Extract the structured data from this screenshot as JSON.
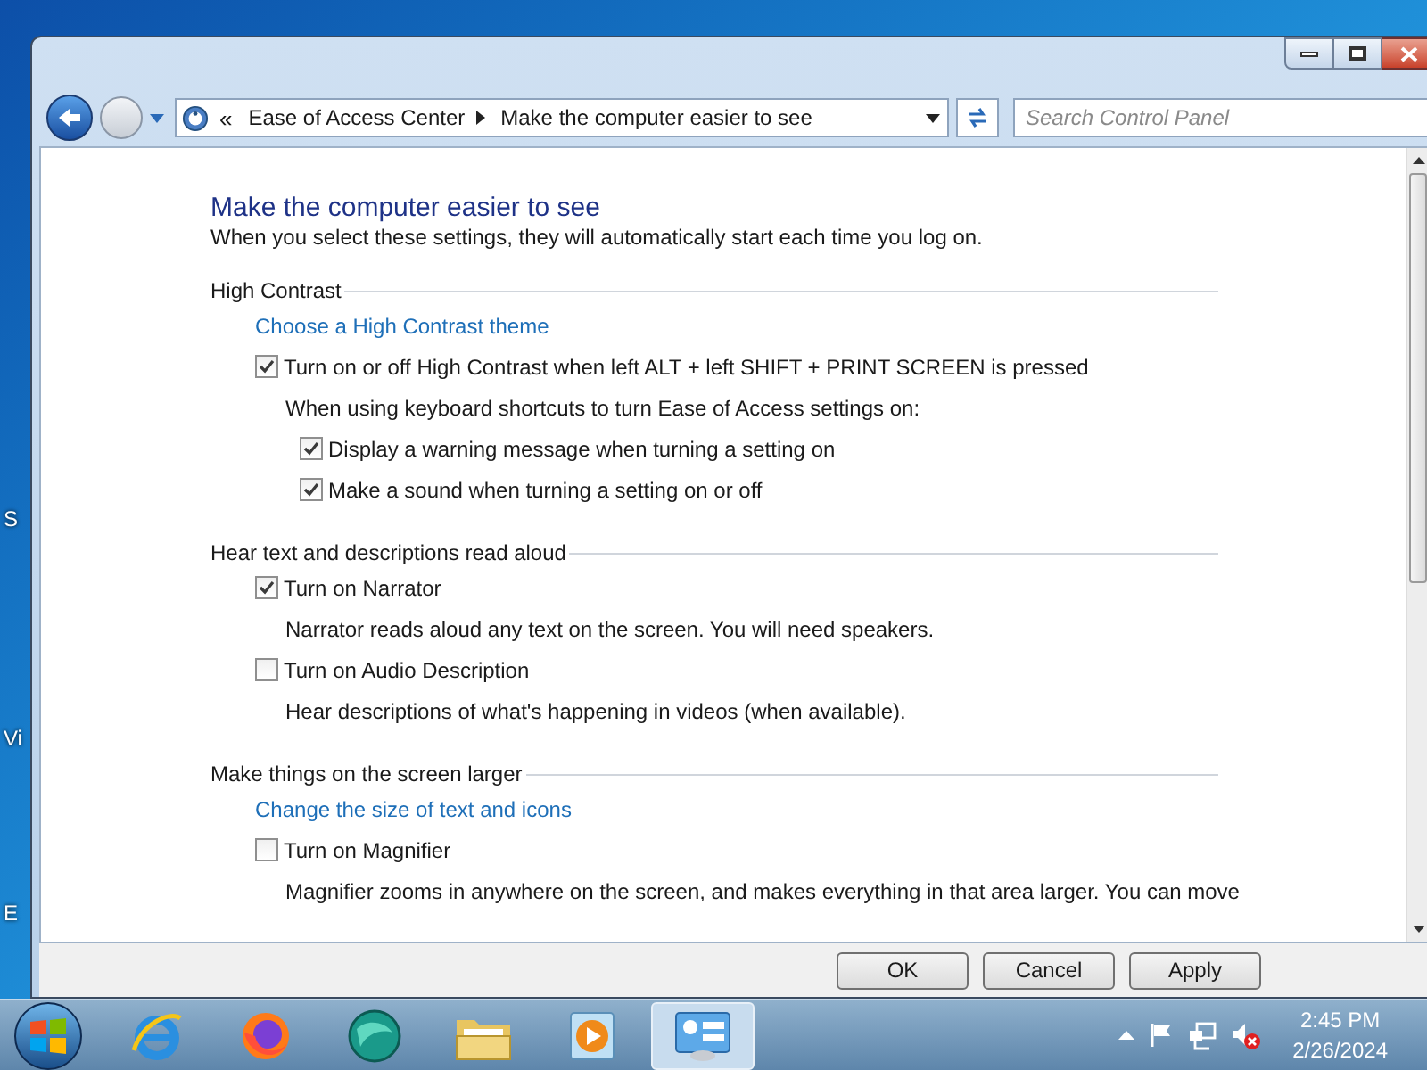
{
  "desktop": {
    "labels": [
      "S",
      "Vi",
      "E"
    ]
  },
  "window": {
    "breadcrumb": [
      "Ease of Access Center",
      "Make the computer easier to see"
    ],
    "overflow_mark": "«",
    "search": {
      "placeholder": "Search Control Panel"
    },
    "content": {
      "title": "Make the computer easier to see",
      "subtitle": "When you select these settings, they will automatically start each time you log on.",
      "sections": [
        {
          "heading": "High Contrast",
          "items": [
            {
              "kind": "link",
              "text": "Choose a High Contrast theme"
            },
            {
              "kind": "checkbox",
              "label": "Turn on or off High Contrast when left ALT + left SHIFT + PRINT SCREEN is pressed",
              "checked": true,
              "children": [
                {
                  "kind": "note",
                  "text": "When using keyboard shortcuts to turn Ease of Access settings on:"
                },
                {
                  "kind": "checkbox",
                  "label": "Display a warning message when turning a setting on",
                  "checked": true
                },
                {
                  "kind": "checkbox",
                  "label": "Make a sound when turning a setting on or off",
                  "checked": true
                }
              ]
            }
          ]
        },
        {
          "heading": "Hear text and descriptions read aloud",
          "items": [
            {
              "kind": "checkbox",
              "label": "Turn on Narrator",
              "checked": true,
              "children": [
                {
                  "kind": "note",
                  "text": "Narrator reads aloud any text on the screen. You will need speakers."
                }
              ]
            },
            {
              "kind": "checkbox",
              "label": "Turn on Audio Description",
              "checked": false,
              "children": [
                {
                  "kind": "note",
                  "text": "Hear descriptions of what's happening in videos (when available)."
                }
              ]
            }
          ]
        },
        {
          "heading": "Make things on the screen larger",
          "items": [
            {
              "kind": "link",
              "text": "Change the size of text and icons"
            },
            {
              "kind": "checkbox",
              "label": "Turn on Magnifier",
              "checked": false,
              "children": [
                {
                  "kind": "note",
                  "text": "Magnifier zooms in anywhere on the screen, and makes everything in that area larger. You can move"
                }
              ]
            }
          ]
        }
      ]
    },
    "buttons": [
      "OK",
      "Cancel",
      "Apply"
    ]
  },
  "taskbar": {
    "items": [
      {
        "kind": "ie",
        "selected": false
      },
      {
        "kind": "firefox",
        "selected": false
      },
      {
        "kind": "globe",
        "selected": false
      },
      {
        "kind": "folder",
        "selected": false
      },
      {
        "kind": "media",
        "selected": false
      },
      {
        "kind": "control-panel",
        "selected": true
      }
    ],
    "clock": {
      "time": "2:45 PM",
      "date": "2/26/2024"
    }
  }
}
